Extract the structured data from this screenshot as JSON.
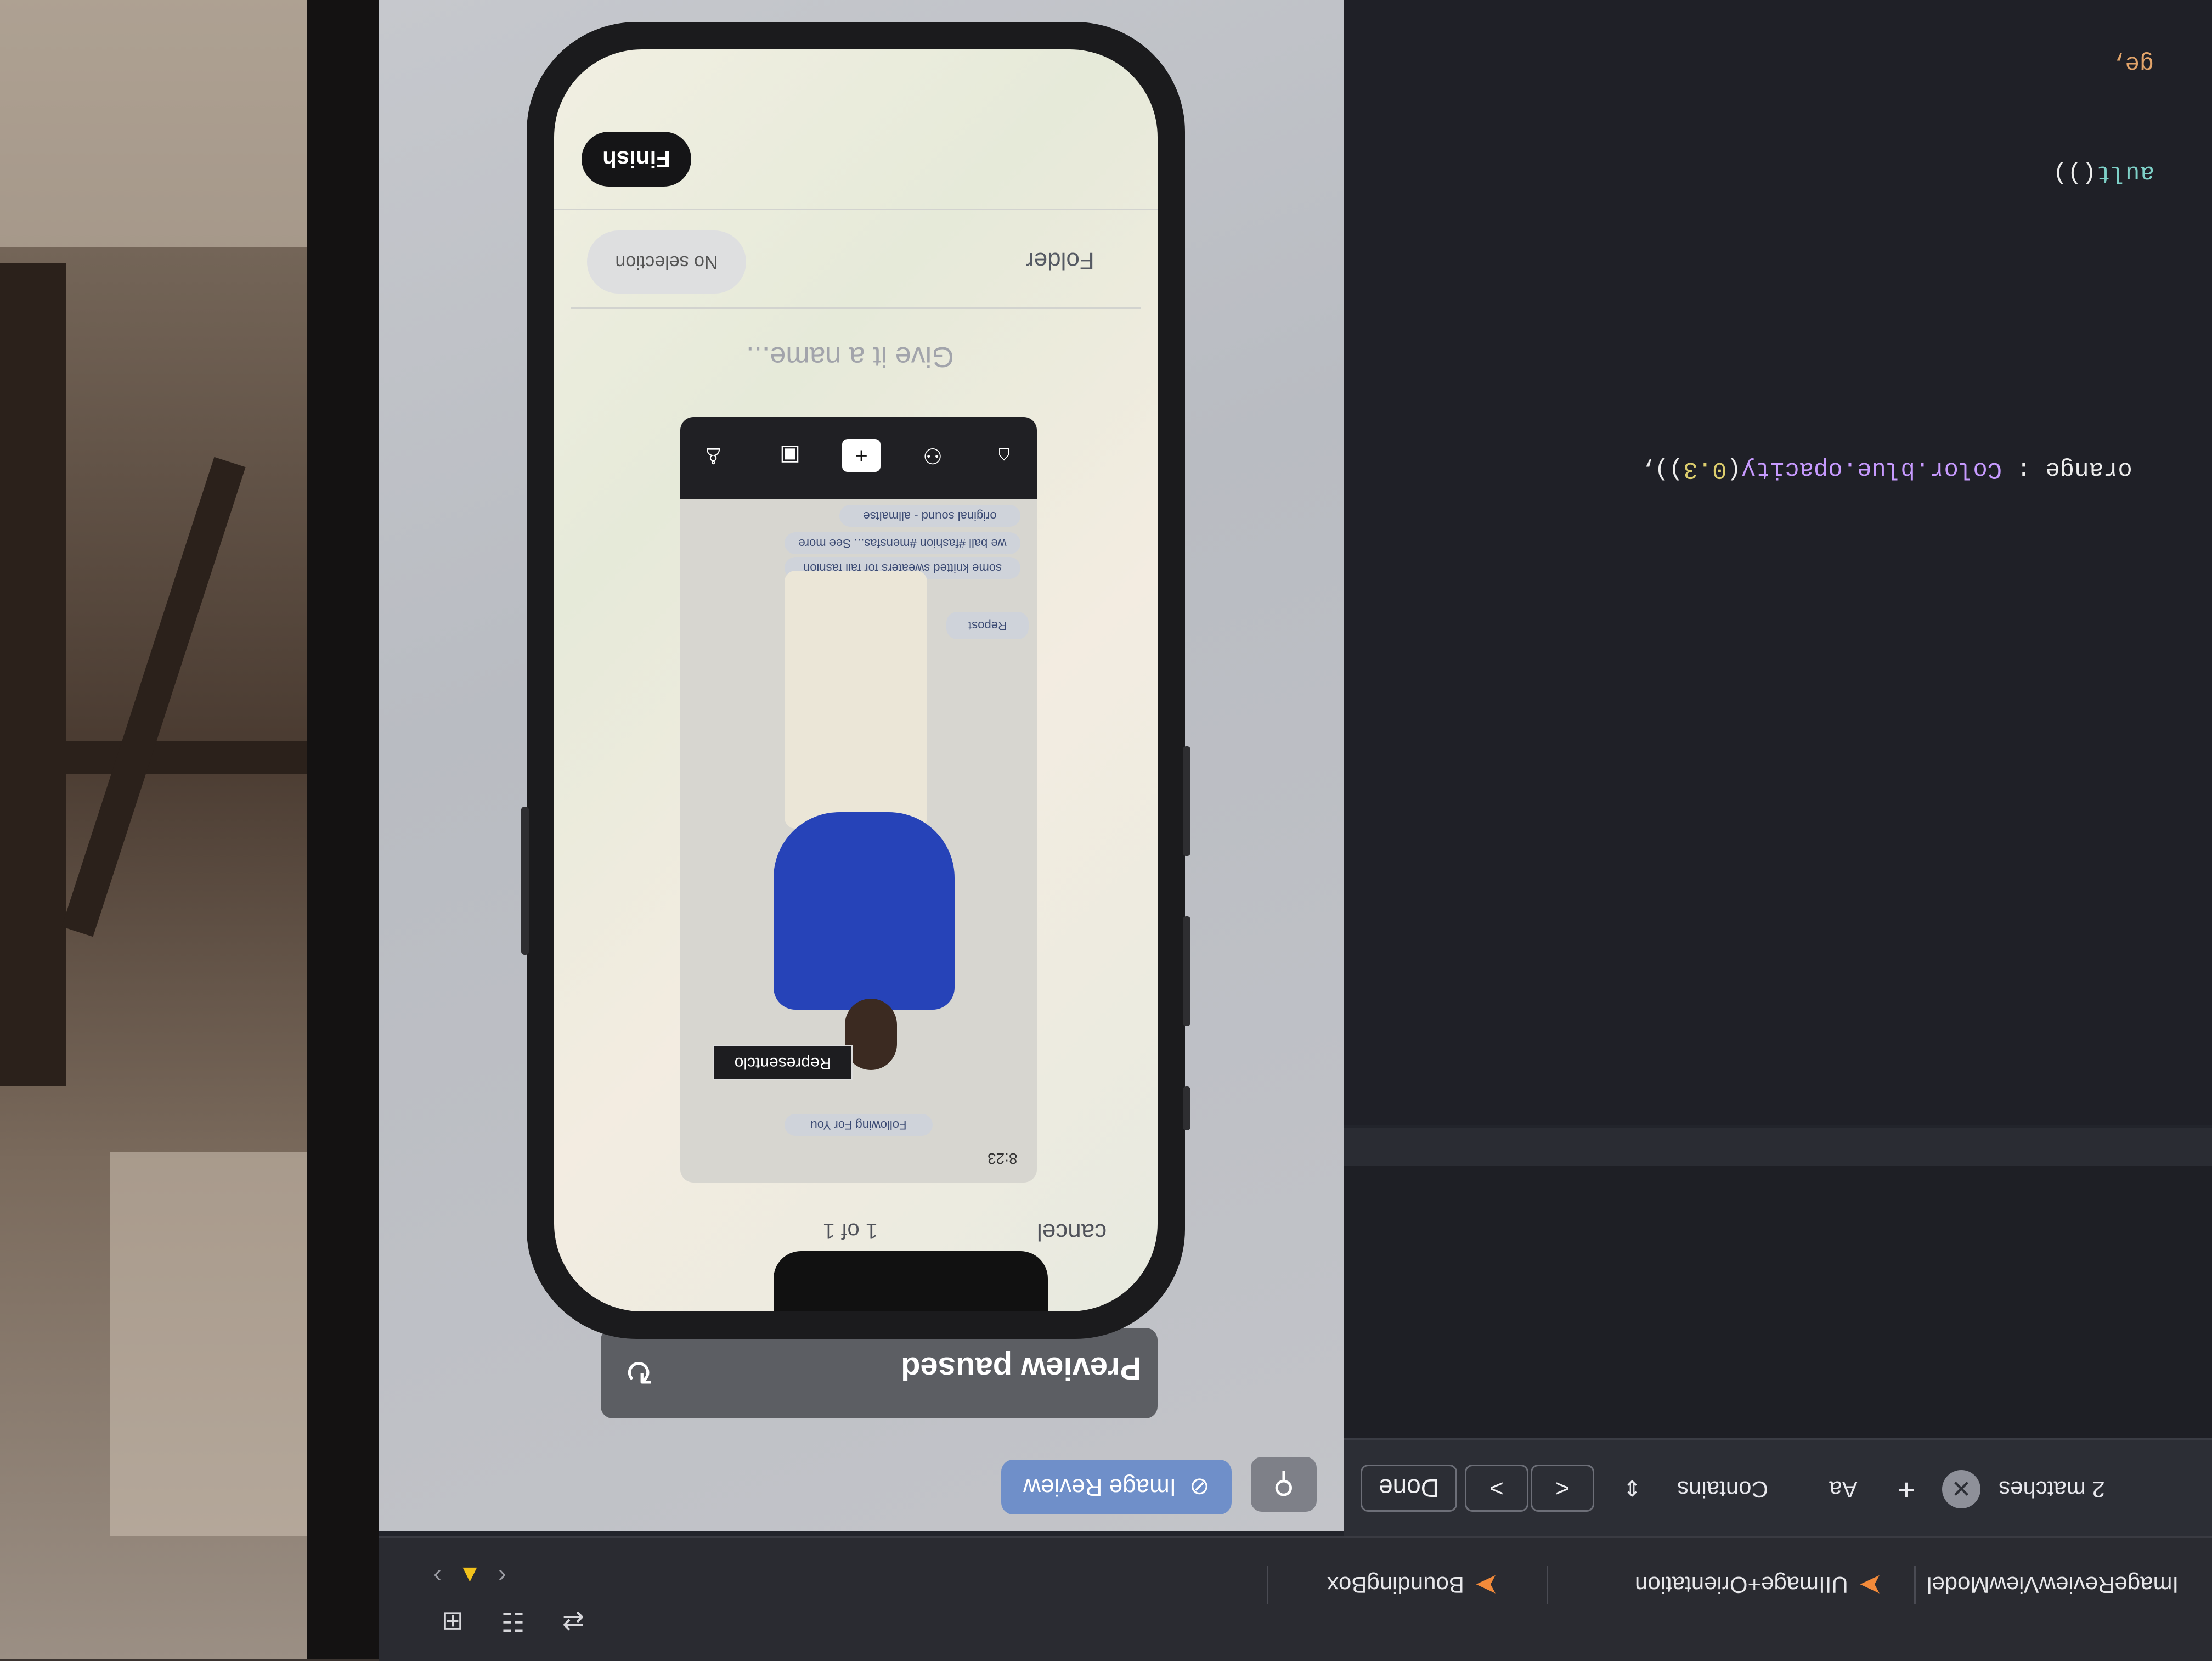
{
  "code": {
    "lines": [
      {
        "parts": [
          {
            "text": "ge,",
            "cls": "kw-orange"
          }
        ]
      },
      {
        "parts": [
          {
            "text": "ault",
            "cls": "kw-teal"
          },
          {
            "text": "())",
            "cls": "kw-white"
          }
        ]
      },
      {
        "parts": [
          {
            "text": "orange",
            "cls": "kw-white"
          },
          {
            "text": " : ",
            "cls": "kw-white"
          },
          {
            "text": "Color",
            "cls": "kw-purple"
          },
          {
            "text": ".blue.opacity",
            "cls": "kw-purple"
          },
          {
            "text": "(",
            "cls": "kw-white"
          },
          {
            "text": "0.3",
            "cls": "kw-yellow"
          },
          {
            "text": ")),",
            "cls": "kw-white"
          }
        ]
      }
    ]
  },
  "find_bar": {
    "matches": "2 matches",
    "add": "+",
    "case": "Aa",
    "mode": "Contains",
    "prev": "<",
    "next": ">",
    "done": "Done"
  },
  "tabs": [
    {
      "label": "ImageReviewViewModel"
    },
    {
      "label": "UIImage+Orientation"
    },
    {
      "label": "BoundingBox"
    }
  ],
  "preview": {
    "badge_label": "Image Review",
    "paused_label": "Preview paused"
  },
  "phone": {
    "finish": "Finish",
    "folder_label": "Folder",
    "folder_value": "No selection",
    "name_placeholder": "Give it a name...",
    "counter": "1 of 1",
    "cancel": "cancel"
  },
  "thumbnail": {
    "caption": "Representclo",
    "time": "8:23",
    "tabs": "Following  For You",
    "repost": "Repost",
    "sound": "original sound - allmaltse",
    "desc": "some knitted sweaters for fall fashion",
    "desc2": "we ball #fashion #mensfas... See more"
  },
  "colors": {
    "accent": "#6f8fc9",
    "editor_bg": "#1f2027",
    "swift": "#f28a3a"
  }
}
